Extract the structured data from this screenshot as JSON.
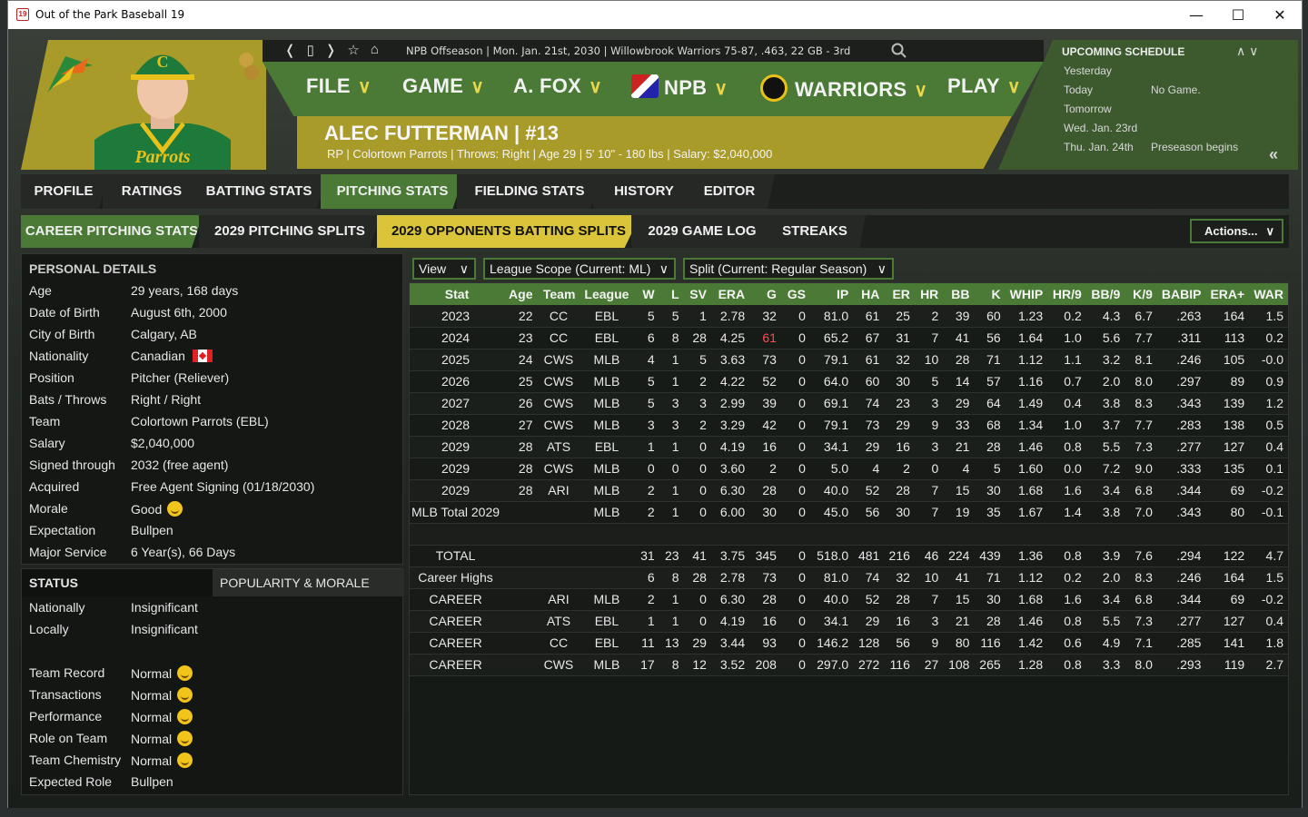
{
  "window": {
    "title": "Out of the Park Baseball 19",
    "app_icon": "19",
    "controls": [
      "minimize",
      "maximize",
      "close"
    ]
  },
  "header": {
    "breadcrumb": "NPB Offseason  |  Mon. Jan. 21st, 2030  |  Willowbrook Warriors  75-87, .463, 22 GB - 3rd",
    "menu": [
      {
        "label": "FILE"
      },
      {
        "label": "GAME"
      },
      {
        "label": "A. FOX"
      },
      {
        "label": "NPB"
      },
      {
        "label": "WARRIORS"
      },
      {
        "label": "PLAY"
      }
    ]
  },
  "player": {
    "name_line": "ALEC FUTTERMAN  |  #13",
    "info_line": "RP | Colortown Parrots  |  Throws: Right  |  Age 29  |  5' 10\" - 180 lbs  |  Salary: $2,040,000",
    "jersey_text": "Parrots",
    "cap_letter": "C"
  },
  "schedule": {
    "title": "UPCOMING SCHEDULE",
    "rows": [
      {
        "day": "Yesterday",
        "event": ""
      },
      {
        "day": "Today",
        "event": "No Game."
      },
      {
        "day": "Tomorrow",
        "event": ""
      },
      {
        "day": "Wed. Jan. 23rd",
        "event": ""
      },
      {
        "day": "Thu. Jan. 24th",
        "event": "Preseason begins"
      }
    ],
    "collapse_glyph": "«"
  },
  "tabs_main": [
    "PROFILE",
    "RATINGS",
    "BATTING STATS",
    "PITCHING STATS",
    "FIELDING STATS",
    "HISTORY",
    "EDITOR"
  ],
  "tabs_sub": [
    "CAREER PITCHING STATS",
    "2029 PITCHING SPLITS",
    "2029 OPPONENTS BATTING SPLITS",
    "2029 GAME LOG",
    "STREAKS"
  ],
  "actions_label": "Actions...",
  "personal": {
    "title": "PERSONAL DETAILS",
    "rows": [
      {
        "k": "Age",
        "v": "29 years, 168 days"
      },
      {
        "k": "Date of Birth",
        "v": "August 6th, 2000"
      },
      {
        "k": "City of Birth",
        "v": "Calgary, AB"
      },
      {
        "k": "Nationality",
        "v": "Canadian"
      },
      {
        "k": "Position",
        "v": "Pitcher (Reliever)"
      },
      {
        "k": "Bats / Throws",
        "v": "Right / Right"
      },
      {
        "k": "Team",
        "v": "Colortown Parrots (EBL)"
      },
      {
        "k": "Salary",
        "v": "$2,040,000"
      },
      {
        "k": "Signed through",
        "v": "2032 (free agent)"
      },
      {
        "k": "Acquired",
        "v": "Free Agent Signing (01/18/2030)"
      },
      {
        "k": "Morale",
        "v": "Good"
      },
      {
        "k": "Expectation",
        "v": "Bullpen"
      },
      {
        "k": "Major Service",
        "v": "6 Year(s), 66 Days"
      }
    ]
  },
  "status": {
    "tab_status": "STATUS",
    "tab_popularity": "POPULARITY & MORALE",
    "rows": [
      {
        "k": "Nationally",
        "v": "Insignificant",
        "smile": false
      },
      {
        "k": "Locally",
        "v": "Insignificant",
        "smile": false
      },
      {
        "k": "Team Record",
        "v": "Normal",
        "smile": true
      },
      {
        "k": "Transactions",
        "v": "Normal",
        "smile": true
      },
      {
        "k": "Performance",
        "v": "Normal",
        "smile": true
      },
      {
        "k": "Role on Team",
        "v": "Normal",
        "smile": true
      },
      {
        "k": "Team Chemistry",
        "v": "Normal",
        "smile": true
      },
      {
        "k": "Expected Role",
        "v": "Bullpen",
        "smile": false
      }
    ]
  },
  "filters": {
    "view": "View",
    "scope": "League Scope (Current: ML)",
    "split": "Split (Current: Regular Season)"
  },
  "stats": {
    "columns": [
      "Stat",
      "Age",
      "Team",
      "League",
      "W",
      "L",
      "SV",
      "ERA",
      "G",
      "GS",
      "IP",
      "HA",
      "ER",
      "HR",
      "BB",
      "K",
      "WHIP",
      "HR/9",
      "BB/9",
      "K/9",
      "BABIP",
      "ERA+",
      "WAR"
    ],
    "rows": [
      [
        "2023",
        "22",
        "CC",
        "EBL",
        "5",
        "5",
        "1",
        "2.78",
        "32",
        "0",
        "81.0",
        "61",
        "25",
        "2",
        "39",
        "60",
        "1.23",
        "0.2",
        "4.3",
        "6.7",
        ".263",
        "164",
        "1.5"
      ],
      [
        "2024",
        "23",
        "CC",
        "EBL",
        "6",
        "8",
        "28",
        "4.25",
        "61",
        "0",
        "65.2",
        "67",
        "31",
        "7",
        "41",
        "56",
        "1.64",
        "1.0",
        "5.6",
        "7.7",
        ".311",
        "113",
        "0.2"
      ],
      [
        "2025",
        "24",
        "CWS",
        "MLB",
        "4",
        "1",
        "5",
        "3.63",
        "73",
        "0",
        "79.1",
        "61",
        "32",
        "10",
        "28",
        "71",
        "1.12",
        "1.1",
        "3.2",
        "8.1",
        ".246",
        "105",
        "-0.0"
      ],
      [
        "2026",
        "25",
        "CWS",
        "MLB",
        "5",
        "1",
        "2",
        "4.22",
        "52",
        "0",
        "64.0",
        "60",
        "30",
        "5",
        "14",
        "57",
        "1.16",
        "0.7",
        "2.0",
        "8.0",
        ".297",
        "89",
        "0.9"
      ],
      [
        "2027",
        "26",
        "CWS",
        "MLB",
        "5",
        "3",
        "3",
        "2.99",
        "39",
        "0",
        "69.1",
        "74",
        "23",
        "3",
        "29",
        "64",
        "1.49",
        "0.4",
        "3.8",
        "8.3",
        ".343",
        "139",
        "1.2"
      ],
      [
        "2028",
        "27",
        "CWS",
        "MLB",
        "3",
        "3",
        "2",
        "3.29",
        "42",
        "0",
        "79.1",
        "73",
        "29",
        "9",
        "33",
        "68",
        "1.34",
        "1.0",
        "3.7",
        "7.7",
        ".283",
        "138",
        "0.5"
      ],
      [
        "2029",
        "28",
        "ATS",
        "EBL",
        "1",
        "1",
        "0",
        "4.19",
        "16",
        "0",
        "34.1",
        "29",
        "16",
        "3",
        "21",
        "28",
        "1.46",
        "0.8",
        "5.5",
        "7.3",
        ".277",
        "127",
        "0.4"
      ],
      [
        "2029",
        "28",
        "CWS",
        "MLB",
        "0",
        "0",
        "0",
        "3.60",
        "2",
        "0",
        "5.0",
        "4",
        "2",
        "0",
        "4",
        "5",
        "1.60",
        "0.0",
        "7.2",
        "9.0",
        ".333",
        "135",
        "0.1"
      ],
      [
        "2029",
        "28",
        "ARI",
        "MLB",
        "2",
        "1",
        "0",
        "6.30",
        "28",
        "0",
        "40.0",
        "52",
        "28",
        "7",
        "15",
        "30",
        "1.68",
        "1.6",
        "3.4",
        "6.8",
        ".344",
        "69",
        "-0.2"
      ],
      [
        "MLB Total 2029",
        "",
        "",
        "MLB",
        "2",
        "1",
        "0",
        "6.00",
        "30",
        "0",
        "45.0",
        "56",
        "30",
        "7",
        "19",
        "35",
        "1.67",
        "1.4",
        "3.8",
        "7.0",
        ".343",
        "80",
        "-0.1"
      ],
      [
        "",
        "",
        "",
        "",
        "",
        "",
        "",
        "",
        "",
        "",
        "",
        "",
        "",
        "",
        "",
        "",
        "",
        "",
        "",
        "",
        "",
        "",
        ""
      ],
      [
        "TOTAL",
        "",
        "",
        "",
        "31",
        "23",
        "41",
        "3.75",
        "345",
        "0",
        "518.0",
        "481",
        "216",
        "46",
        "224",
        "439",
        "1.36",
        "0.8",
        "3.9",
        "7.6",
        ".294",
        "122",
        "4.7"
      ],
      [
        "Career Highs",
        "",
        "",
        "",
        "6",
        "8",
        "28",
        "2.78",
        "73",
        "0",
        "81.0",
        "74",
        "32",
        "10",
        "41",
        "71",
        "1.12",
        "0.2",
        "2.0",
        "8.3",
        ".246",
        "164",
        "1.5"
      ],
      [
        "CAREER",
        "",
        "ARI",
        "MLB",
        "2",
        "1",
        "0",
        "6.30",
        "28",
        "0",
        "40.0",
        "52",
        "28",
        "7",
        "15",
        "30",
        "1.68",
        "1.6",
        "3.4",
        "6.8",
        ".344",
        "69",
        "-0.2"
      ],
      [
        "CAREER",
        "",
        "ATS",
        "EBL",
        "1",
        "1",
        "0",
        "4.19",
        "16",
        "0",
        "34.1",
        "29",
        "16",
        "3",
        "21",
        "28",
        "1.46",
        "0.8",
        "5.5",
        "7.3",
        ".277",
        "127",
        "0.4"
      ],
      [
        "CAREER",
        "",
        "CC",
        "EBL",
        "11",
        "13",
        "29",
        "3.44",
        "93",
        "0",
        "146.2",
        "128",
        "56",
        "9",
        "80",
        "116",
        "1.42",
        "0.6",
        "4.9",
        "7.1",
        ".285",
        "141",
        "1.8"
      ],
      [
        "CAREER",
        "",
        "CWS",
        "MLB",
        "17",
        "8",
        "12",
        "3.52",
        "208",
        "0",
        "297.0",
        "272",
        "116",
        "27",
        "108",
        "265",
        "1.28",
        "0.8",
        "3.3",
        "8.0",
        ".293",
        "119",
        "2.7"
      ]
    ]
  },
  "colors": {
    "accent_green": "#4b7a36",
    "gold": "#a99b2a",
    "active_subtab": "#d9c43a",
    "highlight_red": "#ff4a4a"
  }
}
